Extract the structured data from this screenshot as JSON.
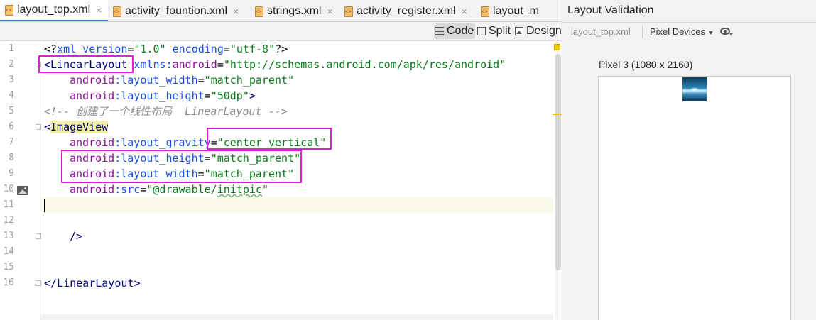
{
  "tabs": [
    {
      "label": "layout_top.xml",
      "active": true
    },
    {
      "label": "activity_fountion.xml",
      "active": false
    },
    {
      "label": "strings.xml",
      "active": false
    },
    {
      "label": "activity_register.xml",
      "active": false
    },
    {
      "label": "layout_m",
      "active": false
    }
  ],
  "close_glyph": "×",
  "view_modes": {
    "code": "Code",
    "split": "Split",
    "design": "Design"
  },
  "line_numbers": [
    "1",
    "2",
    "3",
    "4",
    "5",
    "6",
    "7",
    "8",
    "9",
    "10",
    "11",
    "12",
    "13",
    "14",
    "15",
    "16"
  ],
  "code": {
    "l1": {
      "a": "<?",
      "b": "xml version",
      "c": "=",
      "d": "\"1.0\"",
      "e": " encoding",
      "f": "=",
      "g": "\"utf-8\"",
      "h": "?>"
    },
    "l2": {
      "a": "<",
      "b": "LinearLayout",
      "c": " xmlns:",
      "d": "android",
      "e": "=",
      "f": "\"http://schemas.android.com/apk/res/android\""
    },
    "l3": {
      "ns": "android",
      "attr": ":layout_width",
      "eq": "=",
      "val": "\"match_parent\""
    },
    "l4": {
      "ns": "android",
      "attr": ":layout_height",
      "eq": "=",
      "val": "\"50dp\"",
      "end": ">"
    },
    "l5": {
      "comment": "<!-- 创建了一个线性布局  LinearLayout -->"
    },
    "l6": {
      "a": "<",
      "b": "ImageView"
    },
    "l7": {
      "ns": "android",
      "attr": ":layout_gravity",
      "eq": "=",
      "val": "\"center_vertical\""
    },
    "l8": {
      "ns": "android",
      "attr": ":layout_height",
      "eq": "=",
      "val": "\"match_parent\""
    },
    "l9": {
      "ns": "android",
      "attr": ":layout_width",
      "eq": "=",
      "val": "\"match_parent\""
    },
    "l10": {
      "ns": "android",
      "attr": ":src",
      "eq": "=",
      "val1": "\"@drawable/",
      "val2": "initpic",
      "val3": "\""
    },
    "l13": {
      "text": "/>"
    },
    "l16": {
      "a": "</",
      "b": "LinearLayout",
      "c": ">"
    }
  },
  "validation": {
    "title": "Layout Validation",
    "file": "layout_top.xml",
    "devices": "Pixel Devices",
    "device_label": "Pixel 3 (1080 x 2160)"
  },
  "colors": {
    "highlight_box": "#e020d8",
    "tag": "#000080",
    "attribute": "#1750eb",
    "namespace": "#871094",
    "string_value": "#067d17",
    "comment": "#8c8c8c"
  }
}
